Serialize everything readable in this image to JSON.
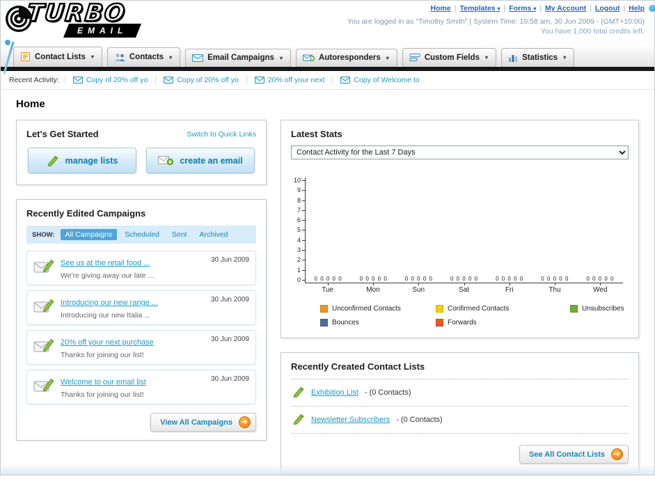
{
  "header": {
    "logo_title": "TURBO",
    "logo_subtitle": "EMAIL",
    "links": [
      {
        "label": "Home",
        "dropdown": false
      },
      {
        "label": "Templates",
        "dropdown": true
      },
      {
        "label": "Forms",
        "dropdown": true
      },
      {
        "label": "My Account",
        "dropdown": false
      },
      {
        "label": "Logout",
        "dropdown": false
      },
      {
        "label": "Help",
        "dropdown": false
      }
    ],
    "login_info": "You are logged in as \"Timothy Smith\" | System Time: 10:58 am, 30 Jun 2009 - (GMT+10:00)",
    "credits": "You have 1,000 total credits left."
  },
  "nav": {
    "items": [
      {
        "label": "Contact Lists",
        "icon": "contact-lists-icon"
      },
      {
        "label": "Contacts",
        "icon": "contacts-icon"
      },
      {
        "label": "Email Campaigns",
        "icon": "email-campaigns-icon"
      },
      {
        "label": "Autoresponders",
        "icon": "autoresponders-icon"
      },
      {
        "label": "Custom Fields",
        "icon": "custom-fields-icon"
      },
      {
        "label": "Statistics",
        "icon": "statistics-icon"
      }
    ]
  },
  "recent_activity": {
    "label": "Recent Activity:",
    "items": [
      "Copy of 20% off yo",
      "Copy of 20% off yo",
      "20% off your next",
      "Copy of Welcome to"
    ]
  },
  "page_title": "Home",
  "get_started": {
    "title": "Let's Get Started",
    "switch_link": "Switch to Quick Links",
    "buttons": [
      {
        "label": "manage lists",
        "icon": "pencil-icon"
      },
      {
        "label": "create an email",
        "icon": "create-email-icon"
      }
    ]
  },
  "campaigns": {
    "title": "Recently Edited Campaigns",
    "show_label": "SHOW:",
    "tabs": [
      "All Campaigns",
      "Scheduled",
      "Sent",
      "Archived"
    ],
    "active_tab": "All Campaigns",
    "items": [
      {
        "title": "See us at the retail food ...",
        "subtitle": "We're giving away our late ...",
        "date": "30 Jun 2009"
      },
      {
        "title": "Introducing our new range ...",
        "subtitle": "Introducing our new Italia ...",
        "date": "30 Jun 2009"
      },
      {
        "title": "20% off your next purchase",
        "subtitle": "Thanks for joining our list!",
        "date": "30 Jun 2009"
      },
      {
        "title": "Welcome to our email list",
        "subtitle": "Thanks for joining our list!",
        "date": "30 Jun 2009"
      }
    ],
    "view_all_label": "View All Campaigns"
  },
  "stats": {
    "title": "Latest Stats",
    "dropdown_value": "Contact Activity for the Last 7 Days",
    "chart_data": {
      "type": "bar",
      "title": "Contact Activity for the Last 7 Days",
      "categories": [
        "Tue",
        "Mon",
        "Sun",
        "Sat",
        "Fri",
        "Thu",
        "Wed"
      ],
      "series": [
        {
          "name": "Unconfirmed Contacts",
          "values": [
            0,
            0,
            0,
            0,
            0,
            0,
            0
          ]
        },
        {
          "name": "Confirmed Contacts",
          "values": [
            0,
            0,
            0,
            0,
            0,
            0,
            0
          ]
        },
        {
          "name": "Unsubscribes",
          "values": [
            0,
            0,
            0,
            0,
            0,
            0,
            0
          ]
        },
        {
          "name": "Bounces",
          "values": [
            0,
            0,
            0,
            0,
            0,
            0,
            0
          ]
        },
        {
          "name": "Forwards",
          "values": [
            0,
            0,
            0,
            0,
            0,
            0,
            0
          ]
        }
      ],
      "ylim": [
        0,
        10
      ],
      "xlabel": "",
      "ylabel": "",
      "grid": false,
      "legend_position": "bottom"
    },
    "legend": [
      {
        "label": "Unconfirmed Contacts",
        "color": "#f7941d"
      },
      {
        "label": "Confirmed Contacts",
        "color": "#ffcc00"
      },
      {
        "label": "Unsubscribes",
        "color": "#71b02f"
      },
      {
        "label": "Bounces",
        "color": "#4f6d9e"
      },
      {
        "label": "Forwards",
        "color": "#e55927"
      }
    ]
  },
  "contact_lists": {
    "title": "Recently Created Contact Lists",
    "items": [
      {
        "name": "Exhibition List",
        "detail": "- (0 Contacts)"
      },
      {
        "name": "Newsletter Subscribers",
        "detail": "- (0 Contacts)"
      }
    ],
    "see_all_label": "See All Contact Lists"
  },
  "colors": {
    "accent_teal": "#1a9cc9",
    "nav_border": "#151515",
    "panel_border": "#c3c9cd",
    "button_blue": "#0e7aa8",
    "arrow_orange": "#ef7d00"
  }
}
